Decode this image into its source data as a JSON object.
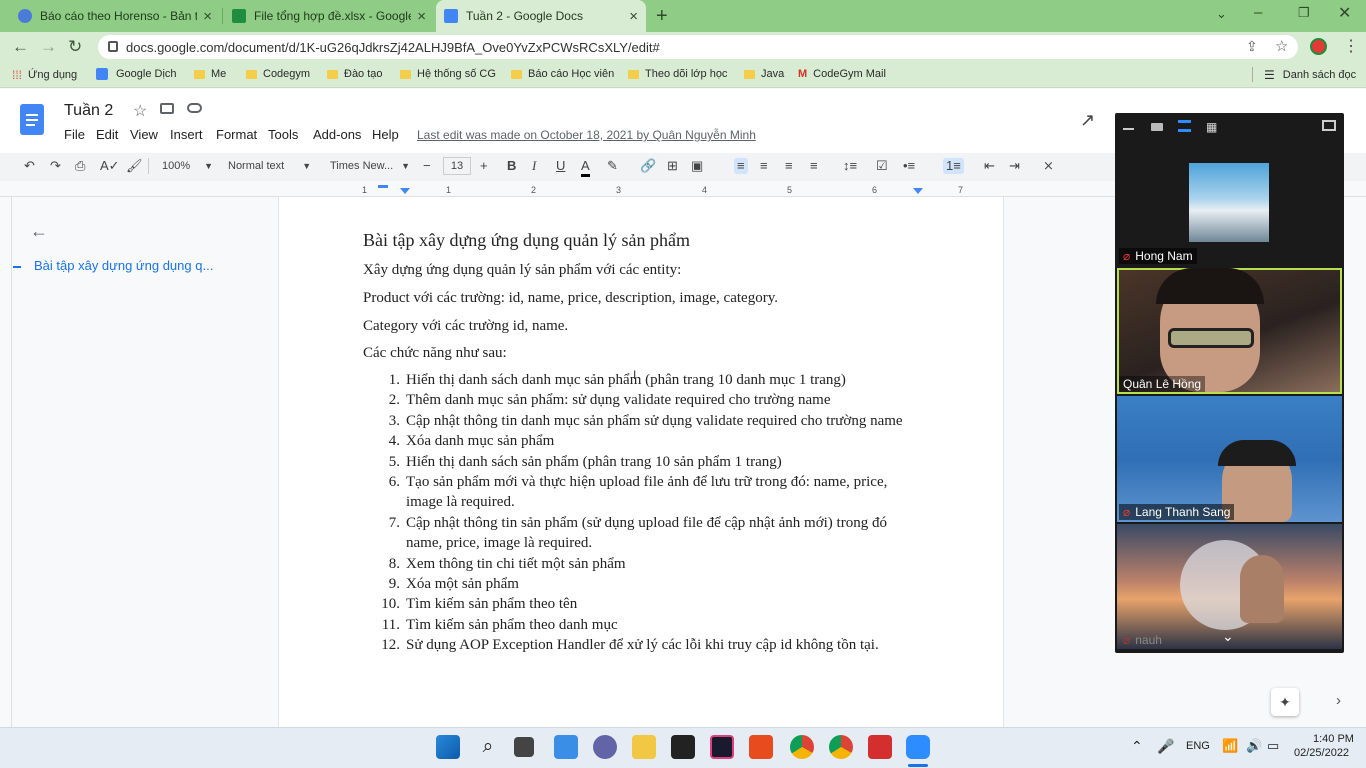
{
  "browser": {
    "tabs": [
      {
        "title": "Báo cáo theo Horenso - Bản thu"
      },
      {
        "title": "File tổng hợp đề.xlsx - Google Sh"
      },
      {
        "title": "Tuần 2 - Google Docs"
      }
    ],
    "url": "docs.google.com/document/d/1K-uG26qJdkrsZj42ALHJ9BfA_Ove0YvZxPCWsRCsXLY/edit#",
    "bookmarks": [
      "Ứng dụng",
      "Google Dịch",
      "Me",
      "Codegym",
      "Đào tạo",
      "Hệ thống số CG",
      "Báo cáo Học viên",
      "Theo dõi lớp học",
      "Java",
      "CodeGym Mail"
    ],
    "reading_list": "Danh sách đọc"
  },
  "docs": {
    "title": "Tuần 2",
    "menu": [
      "File",
      "Edit",
      "View",
      "Insert",
      "Format",
      "Tools",
      "Add-ons",
      "Help"
    ],
    "last_edit": "Last edit was made on October 18, 2021 by Quân Nguyễn Minh",
    "toolbar": {
      "zoom": "100%",
      "style": "Normal text",
      "font": "Times New...",
      "size": "13"
    },
    "ruler_numbers": [
      "1",
      "1",
      "2",
      "3",
      "4",
      "5",
      "6",
      "7"
    ],
    "outline_item": "Bài tập xây dựng ứng dụng q...",
    "heading": "Bài tập xây dựng ứng dụng quản lý sản phẩm",
    "paragraphs": [
      "Xây dựng ứng dụng quản lý sản phẩm với các entity:",
      "Product với các trường: id, name, price, description, image, category.",
      "Category với các trường id, name.",
      "Các chức năng như sau:"
    ],
    "list": [
      {
        "num": "1.",
        "lines": [
          "Hiển thị danh sách danh mục sản phẩm (phân trang 10 danh mục 1 trang)"
        ]
      },
      {
        "num": "2.",
        "lines": [
          "Thêm danh mục sản phẩm: sử dụng validate required cho trường name"
        ]
      },
      {
        "num": "3.",
        "lines": [
          "Cập nhật thông tin danh mục sản phẩm sử dụng validate required cho trường name"
        ]
      },
      {
        "num": "4.",
        "lines": [
          "Xóa danh mục sản phẩm"
        ]
      },
      {
        "num": "5.",
        "lines": [
          "Hiển thị danh sách sản phẩm (phân trang 10 sản phẩm 1 trang)"
        ]
      },
      {
        "num": "6.",
        "lines": [
          "Tạo sản phẩm mới và thực hiện upload file ảnh để lưu trữ trong đó: name, price,",
          "image là required."
        ]
      },
      {
        "num": "7.",
        "lines": [
          "Cập nhật thông tin sản phẩm (sử dụng upload file để cập nhật ảnh mới) trong đó",
          "name, price, image là required."
        ]
      },
      {
        "num": "8.",
        "lines": [
          "Xem thông tin chi tiết một sản phẩm"
        ]
      },
      {
        "num": "9.",
        "lines": [
          "Xóa một sản phẩm"
        ]
      },
      {
        "num": "10.",
        "lines": [
          "Tìm kiếm sản phẩm theo tên"
        ]
      },
      {
        "num": "11.",
        "lines": [
          "Tìm kiếm sản phẩm theo danh mục"
        ]
      },
      {
        "num": "12.",
        "lines": [
          "Sử dụng AOP Exception Handler để xử lý các lỗi khi truy cập id không tồn tại."
        ]
      }
    ]
  },
  "zoom": {
    "participants": [
      "Hong Nam",
      "Quân Lê Hồng",
      "Lang Thanh Sang",
      "nauh"
    ]
  },
  "taskbar": {
    "lang": "ENG",
    "time": "1:40 PM",
    "date": "02/25/2022"
  },
  "colors": {
    "chrome_green": "#8fcc85",
    "docs_blue": "#1a73e8",
    "zoom_dark": "#1a1a1a"
  }
}
